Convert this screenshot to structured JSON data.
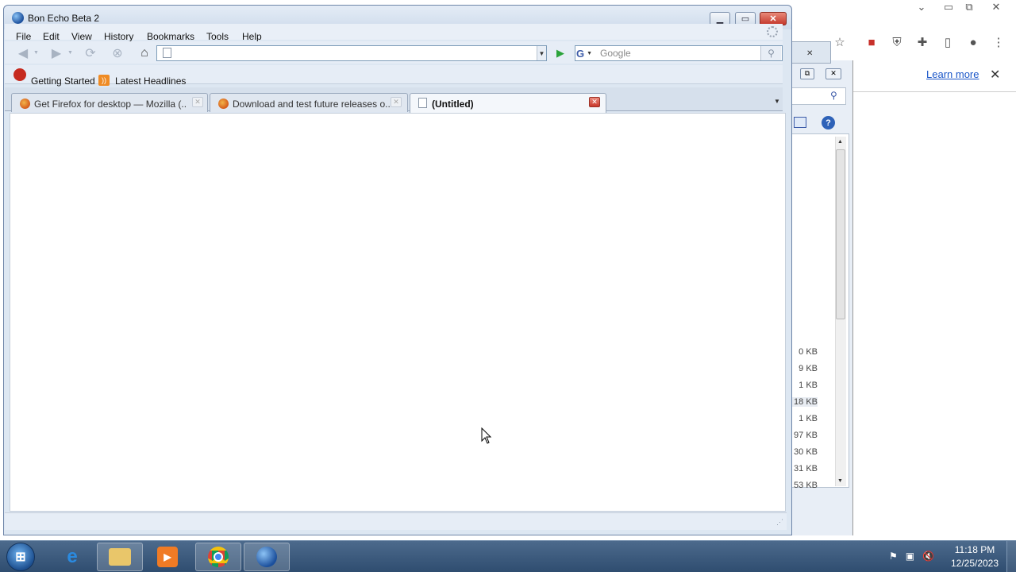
{
  "background_chrome": {
    "infobar": {
      "learn_more": "Learn more"
    },
    "downloads": {
      "sizes": [
        "0 KB",
        "9 KB",
        "1 KB",
        "18 KB",
        "1 KB",
        "97 KB",
        "30 KB",
        "31 KB",
        "53 KB"
      ]
    }
  },
  "bon_echo": {
    "title": "Bon Echo Beta 2",
    "menu": [
      "File",
      "Edit",
      "View",
      "History",
      "Bookmarks",
      "Tools",
      "Help"
    ],
    "url": "",
    "search": {
      "engine": "G",
      "placeholder": "Google"
    },
    "bookmarks": [
      "Getting Started",
      "Latest Headlines"
    ],
    "tabs": [
      {
        "label": "Get Firefox for desktop — Mozilla (...",
        "active": false
      },
      {
        "label": "Download and test future releases o...",
        "active": false
      },
      {
        "label": "(Untitled)",
        "active": true
      }
    ]
  },
  "taskbar": {
    "apps": [
      "internet-explorer",
      "file-explorer",
      "media-player",
      "chrome",
      "bon-echo"
    ],
    "time": "11:18 PM",
    "date": "12/25/2023"
  }
}
